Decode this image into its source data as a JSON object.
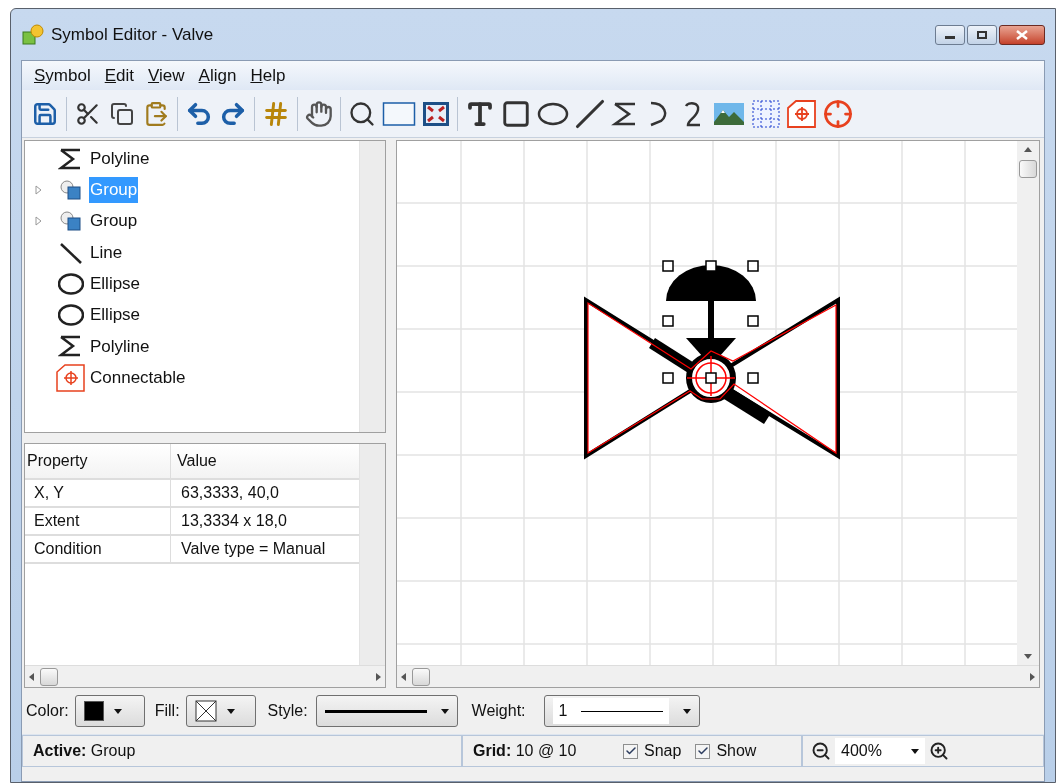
{
  "window": {
    "title": "Symbol Editor - Valve"
  },
  "menu": [
    {
      "label": "Symbol"
    },
    {
      "label": "Edit"
    },
    {
      "label": "View"
    },
    {
      "label": "Align"
    },
    {
      "label": "Help"
    }
  ],
  "tree": [
    {
      "label": "Polyline",
      "kind": "polyline",
      "selected": false
    },
    {
      "label": "Group",
      "kind": "group",
      "selected": true,
      "expanded": false
    },
    {
      "label": "Group",
      "kind": "group",
      "selected": false,
      "expanded": false
    },
    {
      "label": "Line",
      "kind": "line",
      "selected": false
    },
    {
      "label": "Ellipse",
      "kind": "ellipse",
      "selected": false
    },
    {
      "label": "Ellipse",
      "kind": "ellipse",
      "selected": false
    },
    {
      "label": "Polyline",
      "kind": "polyline",
      "selected": false
    },
    {
      "label": "Connectable",
      "kind": "connectable",
      "selected": false
    }
  ],
  "properties": {
    "columns": [
      "Property",
      "Value"
    ],
    "rows": [
      [
        "X, Y",
        "63,3333, 40,0"
      ],
      [
        "Extent",
        "13,3334 x 18,0"
      ],
      [
        "Condition",
        "Valve type = Manual"
      ]
    ]
  },
  "format_bar": {
    "color_label": "Color:",
    "color": "#000000",
    "fill_label": "Fill:",
    "style_label": "Style:",
    "weight_label": "Weight:",
    "weight": "1"
  },
  "status": {
    "active": "**Active:** Group",
    "grid": "**Grid:** 10 @ 10",
    "snap": {
      "label": "Snap",
      "checked": true
    },
    "show": {
      "label": "Show",
      "checked": true
    },
    "zoom": "400%"
  }
}
